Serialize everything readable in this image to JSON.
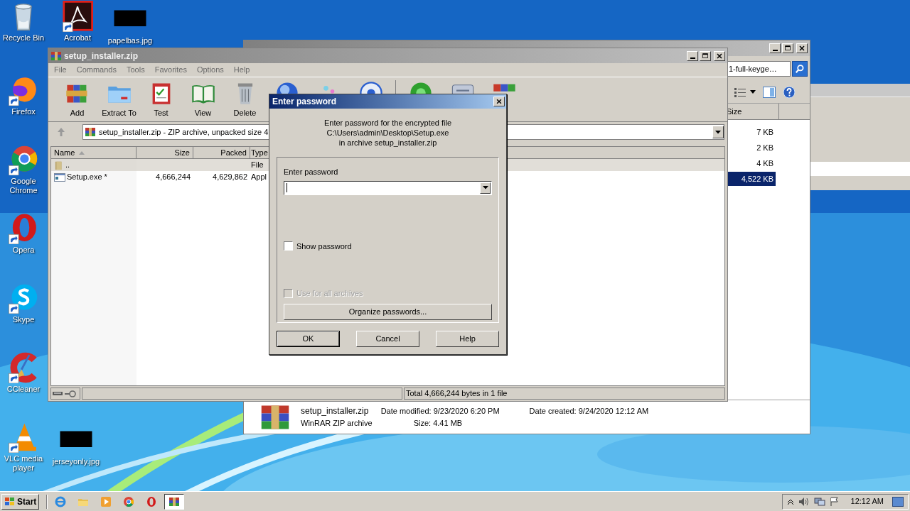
{
  "desktop_icons": [
    {
      "label": "Recycle Bin",
      "kind": "recycle"
    },
    {
      "label": "Acrobat",
      "kind": "acrobat"
    },
    {
      "label": "papelbas.jpg"
    },
    {
      "label": "Firefox",
      "kind": "firefox"
    },
    {
      "label": "Google Chrome",
      "kind": "chrome"
    },
    {
      "label": "Opera",
      "kind": "opera"
    },
    {
      "label": "Skype",
      "kind": "skype"
    },
    {
      "label": "CCleaner",
      "kind": "ccleaner"
    },
    {
      "label": "VLC media player",
      "kind": "vlc"
    },
    {
      "label": "jerseyonly.jpg"
    }
  ],
  "explorer_window": {
    "search": {
      "value": "1-full-keyge…"
    },
    "columns": [
      "Size"
    ],
    "rows": [
      {
        "size": "7 KB",
        "selected": false
      },
      {
        "size": "2 KB",
        "selected": false
      },
      {
        "size": "4 KB",
        "selected": false
      },
      {
        "size": "4,522 KB",
        "selected": true
      }
    ],
    "details": {
      "name": "setup_installer.zip",
      "type": "WinRAR ZIP archive",
      "date_modified": "Date modified: 9/23/2020 6:20 PM",
      "date_created": "Date created: 9/24/2020 12:12 AM",
      "size": "Size: 4.41 MB"
    }
  },
  "winrar": {
    "title": "setup_installer.zip",
    "menu": [
      "File",
      "Commands",
      "Tools",
      "Favorites",
      "Options",
      "Help"
    ],
    "toolbar": [
      {
        "label": "Add",
        "kind": "add"
      },
      {
        "label": "Extract To",
        "kind": "extract"
      },
      {
        "label": "Test",
        "kind": "test"
      },
      {
        "label": "View",
        "kind": "view"
      },
      {
        "label": "Delete",
        "kind": "delete"
      },
      {
        "kind": "find"
      },
      {
        "kind": "wizard"
      },
      {
        "kind": "info"
      },
      {
        "kind": "virus_scan"
      },
      {
        "kind": "comment"
      },
      {
        "kind": "sfx"
      }
    ],
    "path": "setup_installer.zip - ZIP archive, unpacked size 4",
    "columns": [
      "Name",
      "Size",
      "Packed",
      "Type"
    ],
    "files": [
      {
        "name": "..",
        "kind": "folder",
        "type": "File"
      },
      {
        "name": "Setup.exe *",
        "kind": "exe",
        "size": "4,666,244",
        "packed": "4,629,862",
        "type": "Appl"
      }
    ],
    "status": "Total 4,666,244 bytes in 1 file"
  },
  "dialog": {
    "title": "Enter password",
    "message": [
      "Enter password for the encrypted file",
      "C:\\Users\\admin\\Desktop\\Setup.exe",
      "in archive setup_installer.zip"
    ],
    "field_label": "Enter password",
    "checkboxes": [
      {
        "label": "Show password",
        "checked": false,
        "disabled": false
      },
      {
        "label": "Use for all archives",
        "checked": false,
        "disabled": true
      }
    ],
    "organize_button": "Organize passwords...",
    "buttons": [
      {
        "label": "OK",
        "default": true
      },
      {
        "label": "Cancel",
        "default": false
      },
      {
        "label": "Help",
        "default": false
      }
    ]
  },
  "taskbar": {
    "start": "Start",
    "items": [
      {
        "kind": "ie",
        "selected": false
      },
      {
        "kind": "explorer",
        "selected": false
      },
      {
        "kind": "media",
        "selected": false
      },
      {
        "kind": "chrome",
        "selected": false
      },
      {
        "kind": "opera",
        "selected": false
      },
      {
        "kind": "winrar",
        "selected": true
      }
    ],
    "clock": "12:12 AM"
  }
}
